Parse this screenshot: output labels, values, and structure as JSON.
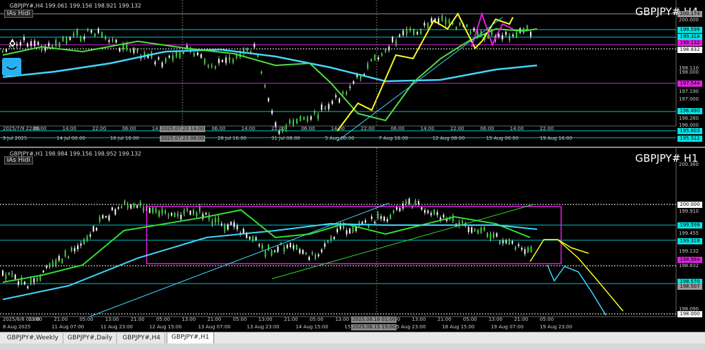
{
  "top_chart": {
    "ohlc_text": "GBPJPY#,H4  199.061 199.156 198.921 199.132",
    "indicator_label": "IAs Hidi",
    "symbol_title": "GBPJPY#  H4",
    "price_labels": [
      {
        "text": "200.174",
        "kind": "box",
        "bg": "#9a9a9a",
        "fg": "#000"
      },
      {
        "text": "200.000",
        "kind": "plain"
      },
      {
        "text": "199.599",
        "kind": "box",
        "bg": "#00e5e5",
        "fg": "#000"
      },
      {
        "text": "199.318",
        "kind": "box",
        "bg": "#00e5e5",
        "fg": "#000"
      },
      {
        "text": "199.132",
        "kind": "box",
        "bg": "#e020e0",
        "fg": "#000"
      },
      {
        "text": "198.832",
        "kind": "box",
        "bg": "#ffffff",
        "fg": "#000"
      },
      {
        "text": "198.110",
        "kind": "plain"
      },
      {
        "text": "198.000",
        "kind": "plain"
      },
      {
        "text": "197.544",
        "kind": "box",
        "bg": "#e020e0",
        "fg": "#000"
      },
      {
        "text": "197.190",
        "kind": "plain"
      },
      {
        "text": "197.000",
        "kind": "plain"
      },
      {
        "text": "196.490",
        "kind": "box",
        "bg": "#00e5e5",
        "fg": "#000"
      },
      {
        "text": "196.280",
        "kind": "plain"
      },
      {
        "text": "196.000",
        "kind": "plain"
      },
      {
        "text": "195.803",
        "kind": "box",
        "bg": "#00e5e5",
        "fg": "#000"
      },
      {
        "text": "195.512",
        "kind": "box",
        "bg": "#00e5e5",
        "fg": "#000"
      }
    ],
    "time_labels": [
      "2025/7/9 22:00",
      "06:00",
      "14:00",
      "22:00",
      "06:00",
      "14:00",
      "22:00",
      "06:00",
      "14:00",
      "22:00",
      "06:00",
      "14:00",
      "22:00",
      "06:00",
      "14:00",
      "22:00",
      "06:00",
      "14:00",
      "22:00"
    ],
    "time_labels_row2": [
      "9 Jul 2025",
      "14 Jul 00:00",
      "16 Jul 16:00",
      "21 Jul",
      "28 Jul 16:00",
      "31 Jul 08:00",
      "5 Aug 00:00",
      "7 Aug 16:00",
      "12 Aug 08:00",
      "15 Aug 00:00",
      "19 Aug 16:00"
    ],
    "crosshair_labels": [
      "2025.07.23 14:00",
      "2025.07.23 08:00"
    ]
  },
  "bottom_chart": {
    "ohlc_text": "GBPJPY#,H1  198.984 199.156 198.952 199.132",
    "indicator_label": "IAs Hidi",
    "symbol_title": "GBPJPY#  H1",
    "price_labels": [
      {
        "text": "200.360",
        "kind": "plain"
      },
      {
        "text": "200.000",
        "kind": "box",
        "bg": "#ffffff",
        "fg": "#000"
      },
      {
        "text": "199.910",
        "kind": "plain"
      },
      {
        "text": "199.599",
        "kind": "box",
        "bg": "#00e5e5",
        "fg": "#000"
      },
      {
        "text": "199.455",
        "kind": "plain"
      },
      {
        "text": "199.318",
        "kind": "box",
        "bg": "#00e5e5",
        "fg": "#000"
      },
      {
        "text": "199.132",
        "kind": "plain"
      },
      {
        "text": "198.984",
        "kind": "box",
        "bg": "#e020e0",
        "fg": "#000"
      },
      {
        "text": "198.832",
        "kind": "plain"
      },
      {
        "text": "198.570",
        "kind": "box",
        "bg": "#00e5e5",
        "fg": "#000"
      },
      {
        "text": "198.507",
        "kind": "box",
        "bg": "#9a9a9a",
        "fg": "#000"
      },
      {
        "text": "198.090",
        "kind": "plain"
      },
      {
        "text": "198.000",
        "kind": "box",
        "bg": "#ffffff",
        "fg": "#000"
      }
    ],
    "time_labels": [
      "2025/8/8 05:00",
      "13:00",
      "21:00",
      "05:00",
      "13:00",
      "21:00",
      "05:00",
      "13:00",
      "21:00",
      "05:00",
      "13:00",
      "21:00",
      "05:00",
      "13:00",
      "21:00",
      "05:00",
      "13:00",
      "21:00",
      "05:00",
      "13:00",
      "21:00",
      "05:00"
    ],
    "time_labels_row2": [
      "8 Aug 2025",
      "11 Aug 07:00",
      "11 Aug 23:00",
      "12 Aug 15:00",
      "13 Aug 07:00",
      "13 Aug 23:00",
      "14 Aug 15:00",
      "15 Aug 07:00",
      "15 Aug 23:00",
      "18 Aug 15:00",
      "19 Aug 07:00",
      "19 Aug 23:00"
    ],
    "crosshair_labels": [
      "2025.08.16 01:00",
      "2025.08.15 19:00"
    ]
  },
  "tabs": [
    "GBPJPY#,Weekly",
    "GBPJPY#,Daily",
    "GBPJPY#,H4",
    "GBPJPY#,H1"
  ],
  "active_tab": "GBPJPY#,H1",
  "colors": {
    "cyan": "#00e5e5",
    "magenta": "#e020e0",
    "yellow": "#ffff20",
    "green": "#30e030",
    "skyblue": "#40d8ff"
  }
}
